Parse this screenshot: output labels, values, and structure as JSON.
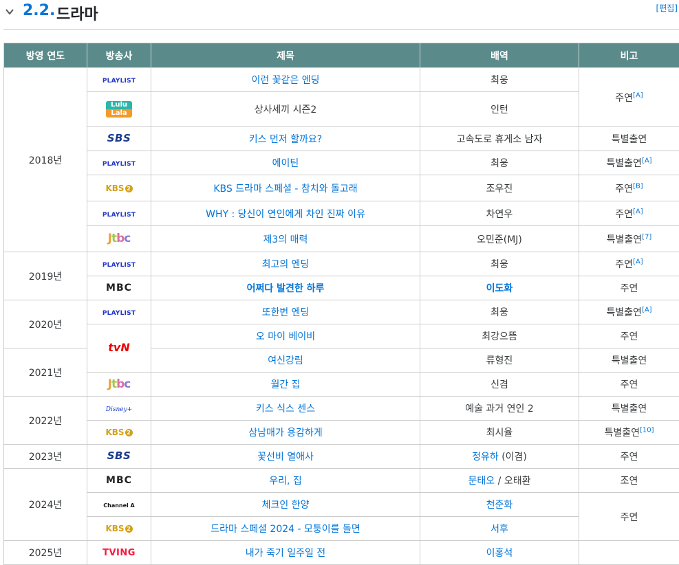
{
  "header": {
    "number": "2.2.",
    "title": "드라마",
    "edit": "[편집]"
  },
  "table": {
    "columns": [
      "방영 연도",
      "방송사",
      "제목",
      "배역",
      "비고"
    ],
    "years": [
      "2018년",
      "2019년",
      "2020년",
      "2021년",
      "2022년",
      "2023년",
      "2024년",
      "2025년"
    ],
    "logos": {
      "playlist": "PLAYLIST",
      "sbs": "SBS",
      "kbs": "KBS",
      "kbs_num": "2",
      "jtbc_j": "J",
      "jtbc_t": "t",
      "jtbc_b": "b",
      "jtbc_c": "c",
      "mbc": "MBC",
      "tvn": "tvN",
      "disney": "Disney+",
      "channel": "Channel A",
      "tving": "TVING",
      "lulu_top": "Lulu",
      "lulu_bottom": "Lala"
    },
    "rows": [
      {
        "title": "이런 꽃같은 엔딩",
        "role": "최웅",
        "note": "주연",
        "ref": "[A]"
      },
      {
        "title": "상사세끼 시즌2",
        "role": "인턴"
      },
      {
        "title": "키스 먼저 할까요?",
        "role": "고속도로 휴게소 남자",
        "note": "특별출연"
      },
      {
        "title": "에이틴",
        "role": "최웅",
        "note": "특별출연",
        "ref": "[A]"
      },
      {
        "title": "KBS 드라마 스페셜 - 참치와 돌고래",
        "role": "조우진",
        "note": "주연",
        "ref": "[B]"
      },
      {
        "title": "WHY : 당신이 연인에게 차인 진짜 이유",
        "role": "차연우",
        "note": "주연",
        "ref": "[A]"
      },
      {
        "title": "제3의 매력",
        "role": "오민준(MJ)",
        "note": "특별출연",
        "ref": "[7]"
      },
      {
        "title": "최고의 엔딩",
        "role": "최웅",
        "note": "주연",
        "ref": "[A]"
      },
      {
        "title": "어쩌다 발견한 하루",
        "role": "이도화",
        "note": "주연"
      },
      {
        "title": "또한번 엔딩",
        "role": "최웅",
        "note": "특별출연",
        "ref": "[A]"
      },
      {
        "title": "오 마이 베이비",
        "role": "최강으뜸",
        "note": "주연"
      },
      {
        "title": "여신강림",
        "role": "류형진",
        "note": "특별출연"
      },
      {
        "title": "월간 집",
        "role": "신겸",
        "note": "주연"
      },
      {
        "title": "키스 식스 센스",
        "role": "예술 과거 연인 2",
        "note": "특별출연"
      },
      {
        "title": "삼남매가 용감하게",
        "role": "최시율",
        "note": "특별출연",
        "ref": "[10]"
      },
      {
        "title": "꽃선비 열애사",
        "role": "정유하",
        "role_extra": "(이겸)",
        "note": "주연"
      },
      {
        "title": "우리, 집",
        "role": "문태오",
        "role_sep": " / ",
        "role_b": "오태환",
        "note": "조연"
      },
      {
        "title": "체크인 한양",
        "role": "천준화",
        "note": "주연"
      },
      {
        "title": "드라마 스페셜 2024 - 모퉁이를 돌면",
        "role": "서후"
      },
      {
        "title": "내가 죽기 일주일 전",
        "role": "이홍석"
      }
    ]
  }
}
